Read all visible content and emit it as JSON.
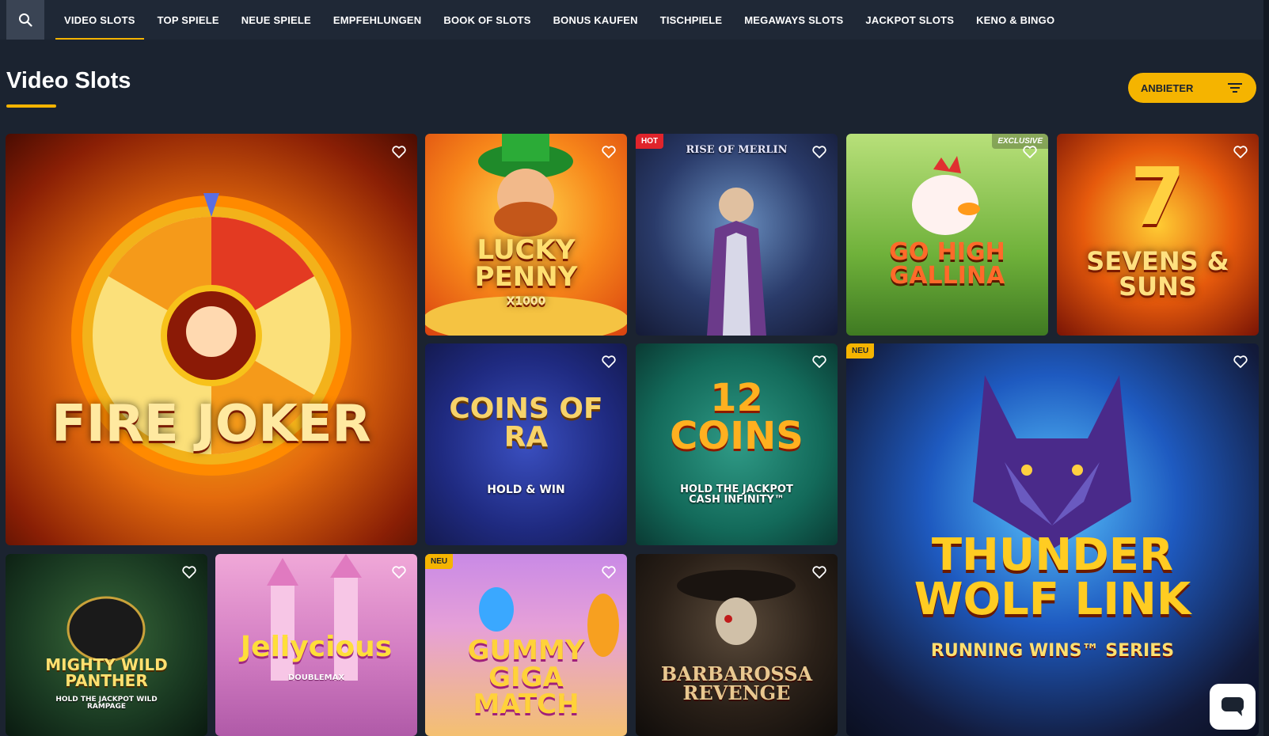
{
  "search": {
    "icon": "search-icon"
  },
  "nav": {
    "items": [
      {
        "label": "VIDEO SLOTS",
        "active": true
      },
      {
        "label": "TOP SPIELE"
      },
      {
        "label": "NEUE SPIELE"
      },
      {
        "label": "EMPFEHLUNGEN"
      },
      {
        "label": "BOOK OF SLOTS"
      },
      {
        "label": "BONUS KAUFEN"
      },
      {
        "label": "TISCHPIELE"
      },
      {
        "label": "MEGAWAYS SLOTS"
      },
      {
        "label": "JACKPOT SLOTS"
      },
      {
        "label": "KENO & BINGO"
      }
    ]
  },
  "page": {
    "title": "Video Slots"
  },
  "filter": {
    "label": "ANBIETER",
    "icon": "filter-icon"
  },
  "games": [
    {
      "title": "FIRE JOKER",
      "badge": ""
    },
    {
      "title": "LUCKY PENNY",
      "subtitle": "X1000",
      "badge": ""
    },
    {
      "title": "RISE OF MERLIN",
      "badge": "HOT"
    },
    {
      "title": "GO HIGH GALLINA",
      "badge": "EXCLUSIVE"
    },
    {
      "title": "SEVENS & SUNS",
      "badge": ""
    },
    {
      "title": "COINS OF RA",
      "subtitle": "HOLD & WIN",
      "badge": ""
    },
    {
      "title": "12 COINS",
      "subtitle": "HOLD THE JACKPOT CASH INFINITY™",
      "badge": ""
    },
    {
      "title": "THUNDER WOLF LINK",
      "subtitle": "RUNNING WINS™ SERIES",
      "badge": "NEU"
    },
    {
      "title": "MIGHTY WILD PANTHER",
      "subtitle": "HOLD THE JACKPOT WILD RAMPAGE",
      "badge": ""
    },
    {
      "title": "Jellycious",
      "subtitle": "DOUBLEMAX",
      "badge": ""
    },
    {
      "title": "GUMMY GIGA MATCH",
      "badge": "NEU"
    },
    {
      "title": "BARBAROSSA REVENGE",
      "badge": ""
    }
  ],
  "colors": {
    "accent": "#f5b400",
    "background": "#1b2330",
    "hot": "#e0242b"
  },
  "chat": {
    "icon": "chat-icon"
  }
}
